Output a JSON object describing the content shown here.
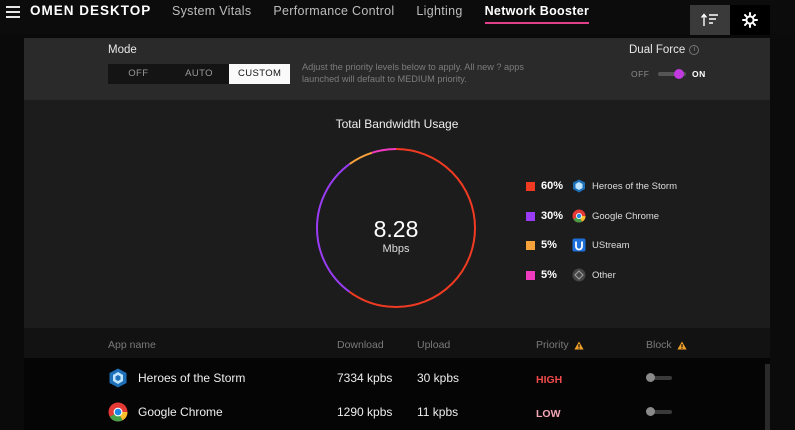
{
  "app": {
    "title": "OMEN DESKTOP"
  },
  "nav": {
    "tabs": [
      {
        "label": "System Vitals"
      },
      {
        "label": "Performance Control"
      },
      {
        "label": "Lighting"
      },
      {
        "label": "Network Booster"
      }
    ],
    "active_tab": "Network Booster"
  },
  "mode": {
    "title": "Mode",
    "options": [
      "OFF",
      "AUTO",
      "CUSTOM"
    ],
    "selected": "CUSTOM",
    "note": "Adjust the priority levels below to apply. All new ? apps launched will default to MEDIUM priority."
  },
  "dual_force": {
    "title": "Dual Force",
    "off_label": "OFF",
    "on_label": "ON",
    "enabled": true
  },
  "bandwidth": {
    "title": "Total Bandwidth Usage",
    "value": "8.28",
    "unit": "Mbps",
    "legend": [
      {
        "percent": "60%",
        "name": "Heroes of the Storm",
        "color": "#f03a22",
        "icon": "heroes-of-the-storm-icon"
      },
      {
        "percent": "30%",
        "name": "Google Chrome",
        "color": "#9a3cf5",
        "icon": "google-chrome-icon"
      },
      {
        "percent": "5%",
        "name": "UStream",
        "color": "#f7a13a",
        "icon": "ustream-icon"
      },
      {
        "percent": "5%",
        "name": "Other",
        "color": "#f03ac0",
        "icon": "other-app-icon"
      }
    ]
  },
  "table": {
    "headers": {
      "app": "App name",
      "download": "Download",
      "upload": "Upload",
      "priority": "Priority",
      "block": "Block"
    },
    "rows": [
      {
        "name": "Heroes of the Storm",
        "download": "7334 kpbs",
        "upload": "30 kpbs",
        "priority": "HIGH",
        "priority_color": "#f04a4a",
        "blocked": false,
        "icon": "heroes-of-the-storm-icon"
      },
      {
        "name": "Google Chrome",
        "download": "1290 kpbs",
        "upload": "11 kpbs",
        "priority": "LOW",
        "priority_color": "#f4a6b4",
        "blocked": false,
        "icon": "google-chrome-icon"
      }
    ]
  },
  "colors": {
    "accent": "#e0408a",
    "toggle_on": "#c13ae0",
    "warning": "#f0a028"
  }
}
